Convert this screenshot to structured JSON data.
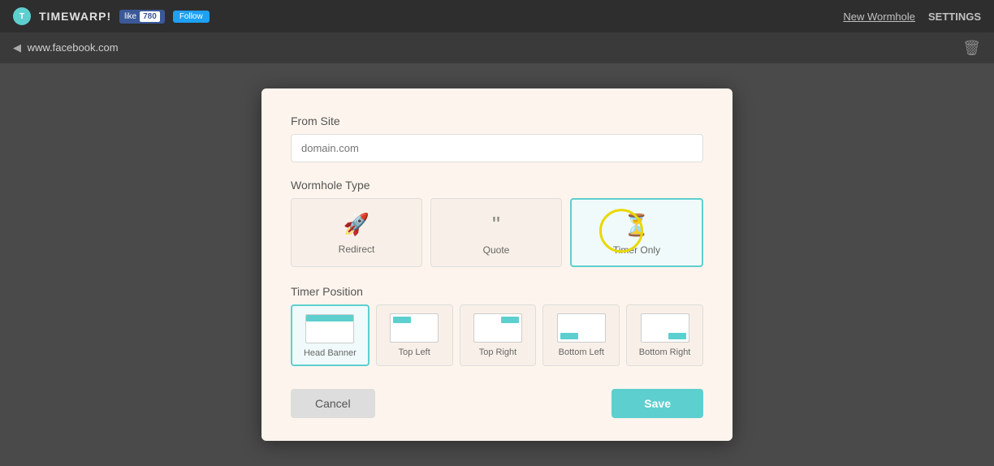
{
  "topNav": {
    "logo_label": "T",
    "app_title": "TIMEWARP!",
    "fb_like": "like",
    "fb_count": "780",
    "tw_follow": "Follow",
    "new_wormhole_label": "New Wormhole",
    "settings_label": "SETTINGS"
  },
  "secondBar": {
    "url": "www.facebook.com"
  },
  "modal": {
    "from_site_label": "From Site",
    "from_site_placeholder": "domain.com",
    "wormhole_type_label": "Wormhole Type",
    "types": [
      {
        "id": "redirect",
        "icon": "🚀",
        "label": "Redirect",
        "selected": false
      },
      {
        "id": "quote",
        "icon": "❝",
        "label": "Quote",
        "selected": false
      },
      {
        "id": "timer_only",
        "icon": "⏳",
        "label": "Timer Only",
        "selected": true
      }
    ],
    "timer_position_label": "Timer Position",
    "positions": [
      {
        "id": "head_banner",
        "label": "Head Banner",
        "selected": true,
        "preview_class": "head-banner"
      },
      {
        "id": "top_left",
        "label": "Top Left",
        "selected": false,
        "preview_class": "top-left"
      },
      {
        "id": "top_right",
        "label": "Top Right",
        "selected": false,
        "preview_class": "top-right"
      },
      {
        "id": "bottom_left",
        "label": "Bottom Left",
        "selected": false,
        "preview_class": "bottom-left"
      },
      {
        "id": "bottom_right",
        "label": "Bottom Right",
        "selected": false,
        "preview_class": "bottom-right"
      }
    ],
    "cancel_label": "Cancel",
    "save_label": "Save"
  },
  "colors": {
    "accent": "#5ecfcf",
    "accent_yellow": "#e8d800"
  }
}
